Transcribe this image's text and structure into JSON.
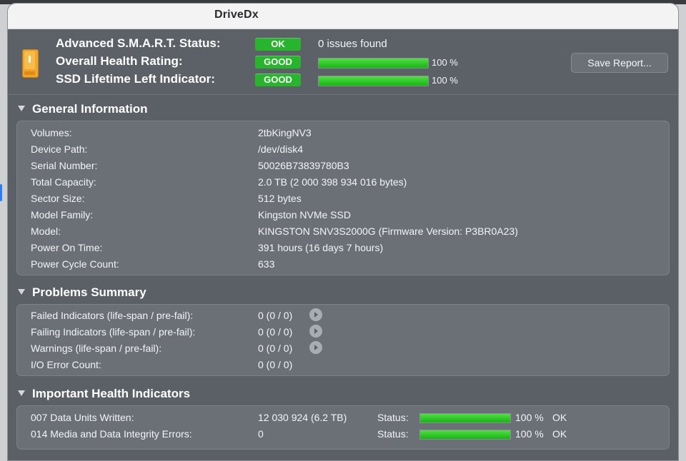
{
  "window": {
    "title": "DriveDx"
  },
  "status": {
    "smart_label": "Advanced S.M.A.R.T. Status:",
    "smart_badge": "OK",
    "smart_text": "0 issues found",
    "health_label": "Overall Health Rating:",
    "health_badge": "GOOD",
    "health_percent_text": "100 %",
    "health_fraction": 1.0,
    "ssd_label": "SSD Lifetime Left Indicator:",
    "ssd_badge": "GOOD",
    "ssd_percent_text": "100 %",
    "ssd_fraction": 1.0,
    "badge_color": "#28b42c",
    "bar_color": "#2fcf2b"
  },
  "toolbar": {
    "save_report": "Save Report..."
  },
  "general": {
    "title": "General Information",
    "rows": [
      {
        "key": "Volumes:",
        "value": "2tbKingNV3"
      },
      {
        "key": "Device Path:",
        "value": "/dev/disk4"
      },
      {
        "key": "Serial Number:",
        "value": "50026B73839780B3"
      },
      {
        "key": "Total Capacity:",
        "value": "2.0 TB (2 000 398 934 016 bytes)"
      },
      {
        "key": "Sector Size:",
        "value": "512 bytes"
      },
      {
        "key": "Model Family:",
        "value": "Kingston NVMe SSD"
      },
      {
        "key": "Model:",
        "value": "KINGSTON SNV3S2000G  (Firmware Version: P3BR0A23)"
      },
      {
        "key": "Power On Time:",
        "value": "391 hours (16 days 7 hours)"
      },
      {
        "key": "Power Cycle Count:",
        "value": "633"
      }
    ]
  },
  "problems": {
    "title": "Problems Summary",
    "rows": [
      {
        "key": "Failed Indicators (life-span / pre-fail):",
        "value": "0 (0 / 0)"
      },
      {
        "key": "Failing Indicators (life-span / pre-fail):",
        "value": "0 (0 / 0)"
      },
      {
        "key": "Warnings (life-span / pre-fail):",
        "value": "0 (0 / 0)"
      },
      {
        "key": "I/O Error Count:",
        "value": "0 (0 / 0)"
      }
    ]
  },
  "health": {
    "title": "Important Health Indicators",
    "status_label": "Status:",
    "rows": [
      {
        "key": "007  Data Units Written:",
        "value": "12 030 924 (6.2 TB)",
        "percent_text": "100 %",
        "fraction": 1.0,
        "state": "OK"
      },
      {
        "key": "014  Media and Data Integrity Errors:",
        "value": "0",
        "percent_text": "100 %",
        "fraction": 1.0,
        "state": "OK"
      }
    ]
  }
}
